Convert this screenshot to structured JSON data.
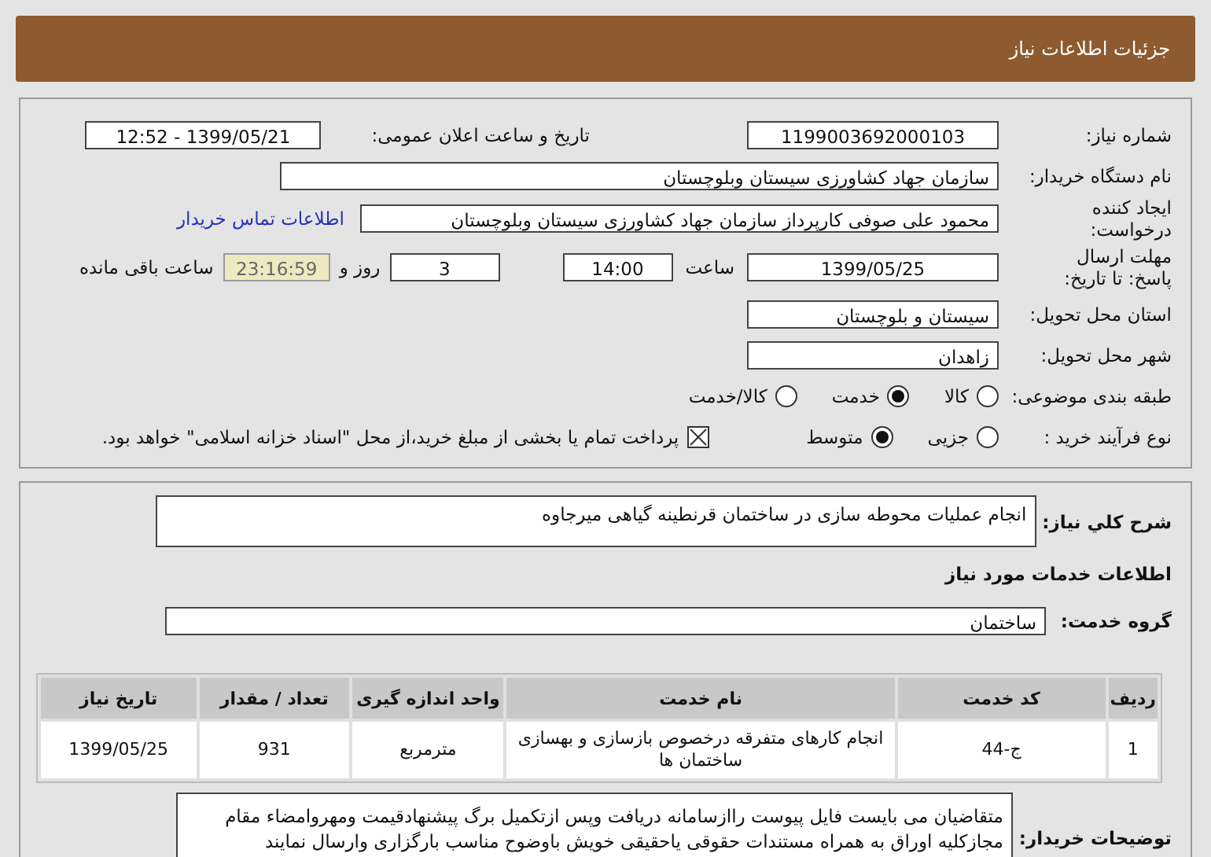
{
  "header": {
    "title": "جزئیات اطلاعات نیاز"
  },
  "need_number": {
    "label": "شماره نیاز:",
    "value": "1199003692000103"
  },
  "announce_date": {
    "label": "تاریخ و ساعت اعلان عمومی:",
    "value": "1399/05/21 - 12:52"
  },
  "buyer_org": {
    "label": "نام دستگاه خریدار:",
    "value": "سازمان جهاد کشاورزی سیستان وبلوچستان"
  },
  "requester": {
    "label": "ایجاد کننده درخواست:",
    "value": "محمود علی صوفی کارپرداز سازمان جهاد کشاورزی سیستان وبلوچستان",
    "link": "اطلاعات تماس خریدار"
  },
  "deadline": {
    "label": "مهلت ارسال پاسخ: تا تاریخ:",
    "date": "1399/05/25",
    "time_label": "ساعت",
    "time": "14:00",
    "days": "3",
    "days_label": "روز و",
    "remaining": "23:16:59",
    "remaining_label": "ساعت باقی مانده"
  },
  "province": {
    "label": "استان محل تحویل:",
    "value": "سیستان و بلوچستان"
  },
  "city": {
    "label": "شهر محل تحویل:",
    "value": "زاهدان"
  },
  "category": {
    "label": "طبقه بندی موضوعی:",
    "options": [
      {
        "label": "کالا",
        "selected": false
      },
      {
        "label": "خدمت",
        "selected": true
      },
      {
        "label": "کالا/خدمت",
        "selected": false
      }
    ]
  },
  "purchase_type": {
    "label": "نوع فرآیند خرید :",
    "options": [
      {
        "label": "جزیی",
        "selected": false
      },
      {
        "label": "متوسط",
        "selected": true
      }
    ],
    "treasury": {
      "label": "پرداخت تمام یا بخشی از مبلغ خرید،از محل \"اسناد خزانه اسلامی\" خواهد بود.",
      "checked": true
    }
  },
  "description": {
    "label": "شرح کلي نیاز:",
    "value": "انجام عملیات محوطه سازی در ساختمان قرنطینه گیاهی میرجاوه"
  },
  "services_heading": "اطلاعات خدمات مورد نیاز",
  "service_group": {
    "label": "گروه خدمت:",
    "value": "ساختمان"
  },
  "table": {
    "columns": [
      "ردیف",
      "کد خدمت",
      "نام خدمت",
      "واحد اندازه گیری",
      "تعداد / مقدار",
      "تاریخ نیاز"
    ],
    "rows": [
      [
        "1",
        "ج-44",
        "انجام کارهای متفرقه درخصوص بازسازی و بهسازی ساختمان ها",
        "مترمربع",
        "931",
        "1399/05/25"
      ]
    ]
  },
  "buyer_notes": {
    "label": "توضیحات خریدار:",
    "value": "متقاضیان می بایست فایل پیوست رااز‌سامانه دریافت وپس ازتکمیل برگ پیشنهادقیمت ومهروامضاء مقام مجازکلیه اوراق به همراه مستندات حقوقی یاحقیقی خویش باوضوح مناسب بارگزاری وارسال نمایند"
  }
}
